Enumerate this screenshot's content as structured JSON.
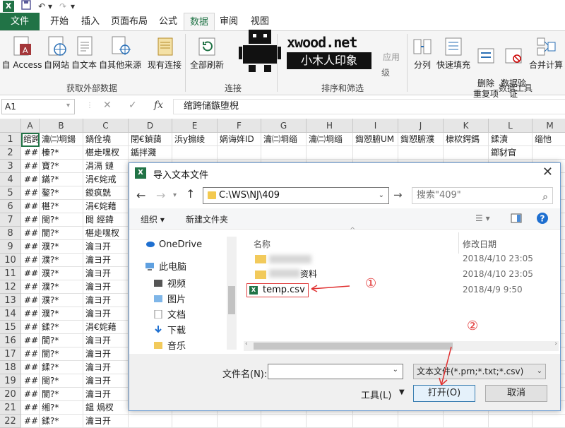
{
  "titlebar": {
    "app_logo": "X",
    "quick_access": [
      "save-icon",
      "undo-icon",
      "redo-icon",
      "customize-icon"
    ]
  },
  "tabs": [
    "文件",
    "开始",
    "插入",
    "页面布局",
    "公式",
    "数据",
    "审阅",
    "视图"
  ],
  "ribbon": {
    "get_external": {
      "buttons": [
        "自 Access",
        "自网站",
        "自文本",
        "自其他来源",
        "现有连接"
      ],
      "label": "获取外部数据"
    },
    "connections": {
      "refresh_all": "全部刷新",
      "label": "连接"
    },
    "sort_filter": {
      "apply": "应用",
      "advanced": "级",
      "label": "排序和筛选"
    },
    "data_tools": {
      "buttons": [
        "分列",
        "快速填充",
        "删除\n重复项",
        "数据验\n证",
        "合并计算"
      ],
      "label": "数据工具"
    }
  },
  "watermark": {
    "line1": "xwood.net",
    "line2": "小木人印象"
  },
  "formula_bar": {
    "namebox": "A1",
    "fx": "fx",
    "content": "绾跨储鏃堕棿"
  },
  "grid": {
    "columns": [
      "A",
      "B",
      "C",
      "D",
      "E",
      "F",
      "G",
      "H",
      "I",
      "J",
      "K",
      "L",
      "M"
    ],
    "rows": [
      "1",
      "2",
      "3",
      "4",
      "5",
      "6",
      "7",
      "8",
      "9",
      "10",
      "11",
      "12",
      "13",
      "14",
      "15",
      "16",
      "17",
      "18",
      "19",
      "20",
      "21",
      "22"
    ],
    "row1": [
      "绾跨",
      "瀹㈡埛鍚",
      "鍋佺墝",
      "閉€鍞藹",
      "浜у搧绫",
      "娲诲姩ID",
      "瀹㈡埛缁",
      "瀹㈡埛缁",
      "鍧愬腑UM",
      "鍧愬腑濮",
      "棣栨鍔鎷",
      "鍒濆",
      "缁忚"
    ],
    "colA": [
      "##",
      "##",
      "##",
      "##",
      "##",
      "##",
      "##",
      "##",
      "##",
      "##",
      "##",
      "##",
      "##",
      "##",
      "##",
      "##",
      "##",
      "##",
      "##",
      "##",
      "##"
    ],
    "colB": [
      "榛?*",
      "寶?*",
      "鏋?*",
      "鏊?*",
      "椹?*",
      "閩?*",
      "閬?*",
      "濮?*",
      "濮?*",
      "濮?*",
      "濮?*",
      "濮?*",
      "濮?*",
      "鍒?*",
      "閬?*",
      "閬?*",
      "鍒?*",
      "閩?*",
      "閬?*",
      "缃?*",
      "鍒?*"
    ],
    "colC": [
      "椹歨嘿杈",
      "涓滆 鏈",
      "涓€姹戒",
      "鍐疯皝",
      "涓€姹藉",
      "閲  經鍏",
      "椹歨嘿杈",
      "瀹ヨ开",
      "瀹ヨ开",
      "瀹ヨ开",
      "瀹ヨ开",
      "瀹ヨ开",
      "瀹ヨ开",
      "涓€姹藉",
      "瀹ヨ开",
      "瀹ヨ开",
      "瀹ヨ开",
      "瀹ヨ开",
      "瀹ヨ开",
      "鎾  煱杈",
      "瀹ヨ开"
    ],
    "colD_row2": "鍎拌濺",
    "colL_row2": "鎯豺窅"
  },
  "dialog": {
    "title": "导入文本文件",
    "address": "C:\\WS\\NJ\\409",
    "search_placeholder": "搜索\"409\"",
    "organize": "组织",
    "new_folder": "新建文件夹",
    "nav_items": [
      "OneDrive",
      "此电脑",
      "视频",
      "图片",
      "文档",
      "下载",
      "音乐"
    ],
    "col_name": "名称",
    "col_date": "修改日期",
    "files": [
      {
        "name": "",
        "date": "2018/4/10 23:05",
        "type": "folder"
      },
      {
        "name": "资料",
        "date": "2018/4/10 23:05",
        "type": "folder"
      },
      {
        "name": "temp.csv",
        "date": "2018/4/9 9:50",
        "type": "csv"
      }
    ],
    "filename_label": "文件名(N):",
    "filename_value": "",
    "filter": "文本文件(*.prn;*.txt;*.csv)",
    "tools": "工具(L)",
    "open": "打开(O)",
    "cancel": "取消"
  },
  "annotations": [
    "①",
    "②"
  ],
  "colors": {
    "excel_green": "#217346",
    "annotation_red": "#e03030"
  }
}
